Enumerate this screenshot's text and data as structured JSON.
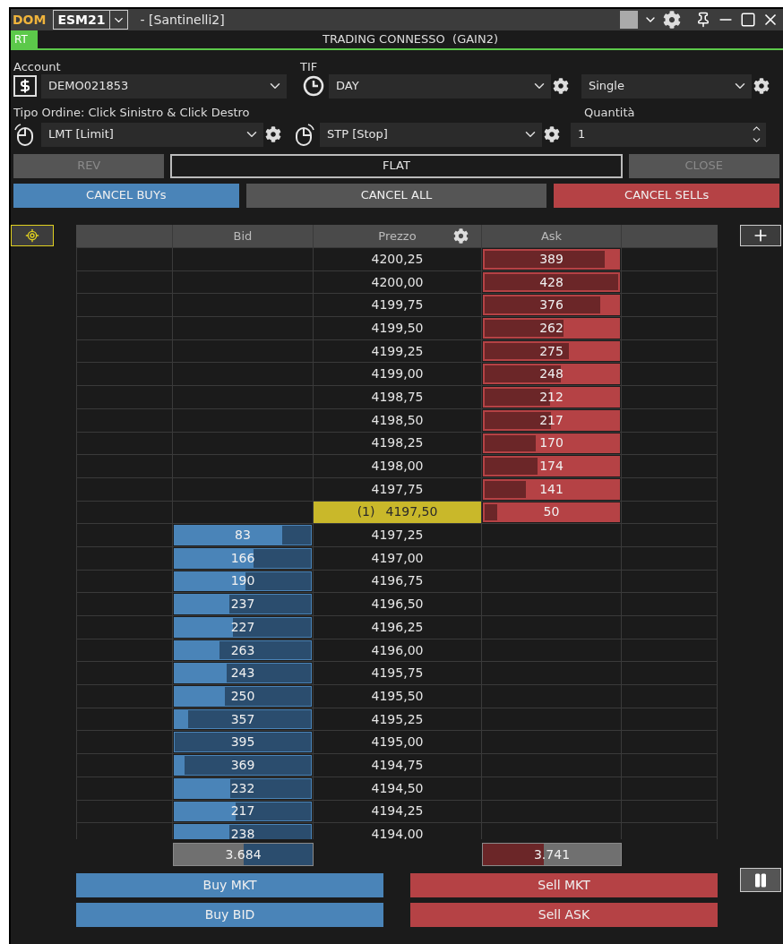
{
  "window": {
    "app_label": "DOM",
    "symbol": "ESM21",
    "title": "- [Santinelli2]"
  },
  "status": {
    "badge": "RT",
    "text": "TRADING CONNESSO  (GAIN2)"
  },
  "order_form": {
    "account_label": "Account",
    "account": "DEMO021853",
    "tif_label": "TIF",
    "tif": "DAY",
    "mode": "Single",
    "order_type_label": "Tipo Ordine: Click Sinistro & Click Destro",
    "left_click_type": "LMT [Limit]",
    "right_click_type": "STP [Stop]",
    "quantity_label": "Quantità",
    "quantity": "1"
  },
  "position_buttons": [
    {
      "label": "REV",
      "kind": "button",
      "disabled": true
    },
    {
      "label": "FLAT",
      "kind": "display",
      "disabled": false
    },
    {
      "label": "CLOSE",
      "kind": "button",
      "disabled": true
    }
  ],
  "cancel_buttons": [
    {
      "label": "CANCEL BUYs",
      "kind": "buy"
    },
    {
      "label": "CANCEL ALL",
      "kind": "all"
    },
    {
      "label": "CANCEL SELLs",
      "kind": "sell"
    }
  ],
  "ladder": {
    "columns": [
      "Bid",
      "Prezzo",
      "Ask"
    ],
    "rows": [
      {
        "price": "4200,25",
        "selected": false,
        "ask": {
          "qty": "389",
          "level": 0.9
        }
      },
      {
        "price": "4200,00",
        "selected": false,
        "ask": {
          "qty": "428",
          "level": 1
        }
      },
      {
        "price": "4199,75",
        "selected": false,
        "ask": {
          "qty": "376",
          "level": 0.87
        }
      },
      {
        "price": "4199,50",
        "selected": false,
        "ask": {
          "qty": "262",
          "level": 0.6
        }
      },
      {
        "price": "4199,25",
        "selected": false,
        "ask": {
          "qty": "275",
          "level": 0.64
        }
      },
      {
        "price": "4199,00",
        "selected": false,
        "ask": {
          "qty": "248",
          "level": 0.58
        }
      },
      {
        "price": "4198,75",
        "selected": false,
        "ask": {
          "qty": "212",
          "level": 0.5
        }
      },
      {
        "price": "4198,50",
        "selected": false,
        "ask": {
          "qty": "217",
          "level": 0.51
        }
      },
      {
        "price": "4198,25",
        "selected": false,
        "ask": {
          "qty": "170",
          "level": 0.4
        }
      },
      {
        "price": "4198,00",
        "selected": false,
        "ask": {
          "qty": "174",
          "level": 0.41
        }
      },
      {
        "price": "4197,75",
        "selected": false,
        "ask": {
          "qty": "141",
          "level": 0.33
        }
      },
      {
        "price": "4197,50",
        "marker": "(1)",
        "selected": true,
        "ask": {
          "qty": "50",
          "level": 0.12
        }
      },
      {
        "price": "4197,25",
        "selected": false,
        "bid": {
          "qty": "83",
          "level": 0.21
        }
      },
      {
        "price": "4197,00",
        "selected": false,
        "bid": {
          "qty": "166",
          "level": 0.42
        }
      },
      {
        "price": "4196,75",
        "selected": false,
        "bid": {
          "qty": "190",
          "level": 0.48
        }
      },
      {
        "price": "4196,50",
        "selected": false,
        "bid": {
          "qty": "237",
          "level": 0.6
        }
      },
      {
        "price": "4196,25",
        "selected": false,
        "bid": {
          "qty": "227",
          "level": 0.57
        }
      },
      {
        "price": "4196,00",
        "selected": false,
        "bid": {
          "qty": "263",
          "level": 0.67
        }
      },
      {
        "price": "4195,75",
        "selected": false,
        "bid": {
          "qty": "243",
          "level": 0.62
        }
      },
      {
        "price": "4195,50",
        "selected": false,
        "bid": {
          "qty": "250",
          "level": 0.63
        }
      },
      {
        "price": "4195,25",
        "selected": false,
        "bid": {
          "qty": "357",
          "level": 0.9
        }
      },
      {
        "price": "4195,00",
        "selected": false,
        "bid": {
          "qty": "395",
          "level": 1
        }
      },
      {
        "price": "4194,75",
        "selected": false,
        "bid": {
          "qty": "369",
          "level": 0.93
        }
      },
      {
        "price": "4194,50",
        "selected": false,
        "bid": {
          "qty": "232",
          "level": 0.59
        }
      },
      {
        "price": "4194,25",
        "selected": false,
        "bid": {
          "qty": "217",
          "level": 0.55
        }
      },
      {
        "price": "4194,00",
        "selected": false,
        "bid": {
          "qty": "238",
          "level": 0.6
        }
      }
    ],
    "totals": {
      "bid": {
        "qty": "3.684",
        "level": 0.5
      },
      "ask": {
        "qty": "3.741",
        "level": 0.44
      }
    }
  },
  "order_buttons": [
    {
      "label": "Buy MKT",
      "kind": "buy"
    },
    {
      "label": "Sell MKT",
      "kind": "sell"
    },
    {
      "label": "Buy BID",
      "kind": "buy"
    },
    {
      "label": "Sell ASK",
      "kind": "sell"
    }
  ]
}
